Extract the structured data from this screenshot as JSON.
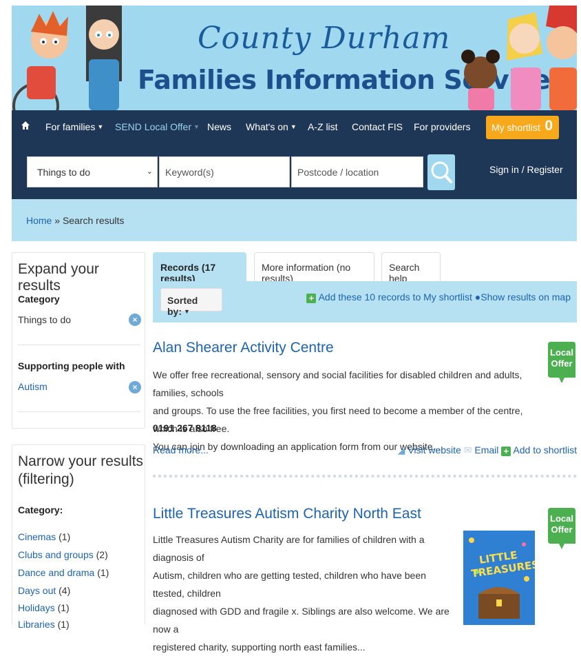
{
  "banner": {
    "title_line1": "County Durham",
    "title_line2": "Families Information Service"
  },
  "nav": {
    "items": [
      {
        "label": "For families",
        "dropdown": true
      },
      {
        "label": "SEND Local Offer",
        "dropdown": true
      },
      {
        "label": "News",
        "dropdown": false
      },
      {
        "label": "What's on",
        "dropdown": true
      },
      {
        "label": "A-Z list",
        "dropdown": false
      },
      {
        "label": "Contact FIS",
        "dropdown": false
      },
      {
        "label": "For providers",
        "dropdown": false
      }
    ],
    "shortlist_label": "My shortlist",
    "shortlist_count": "0",
    "home_icon": "home-icon"
  },
  "search": {
    "category_value": "Things to do",
    "keyword_placeholder": "Keyword(s)",
    "postcode_placeholder": "Postcode / location",
    "signin_label": "Sign in / Register"
  },
  "breadcrumb": {
    "home": "Home",
    "separator": " » ",
    "current": "Search results"
  },
  "sidebar": {
    "expand_heading": "Expand your results",
    "category_label": "Category",
    "category_value": "Things to do",
    "supporting_label": "Supporting people with",
    "supporting_value": "Autism",
    "narrow_heading_1": "Narrow your results",
    "narrow_heading_2": "(filtering)",
    "filter_category_label": "Category:",
    "filter_categories": [
      {
        "name": "Cinemas",
        "count": "(1)"
      },
      {
        "name": "Clubs and groups",
        "count": "(2)"
      },
      {
        "name": "Dance and drama",
        "count": "(1)"
      },
      {
        "name": "Days out",
        "count": "(4)"
      },
      {
        "name": "Holidays",
        "count": "(1)"
      },
      {
        "name": "Libraries",
        "count": "(1)"
      }
    ]
  },
  "tabs": [
    {
      "label": "Records (17 results)",
      "active": true
    },
    {
      "label": "More information (no results)",
      "active": false
    },
    {
      "label": "Search help",
      "active": false
    }
  ],
  "toolbar": {
    "sort_label": "Sorted by:",
    "add_all_label": "Add these 10 records to My shortlist",
    "map_label": "Show results on map"
  },
  "results": [
    {
      "title": "Alan Shearer Activity Centre",
      "desc_lines": [
        "We offer free recreational, sensory and social facilities for disabled children and adults, families, schools",
        "and groups. To use the free facilities, you first need to become a member of the centre, which is also free.",
        "You can join by downloading an application form from our website...."
      ],
      "phone": "0191 267 8118",
      "read_more": "Read more...",
      "visit_website": "Visit website",
      "email": "Email",
      "add_shortlist": "Add to shortlist",
      "badge_line1": "Local",
      "badge_line2": "Offer"
    },
    {
      "title": "Little Treasures Autism Charity North East",
      "desc_lines": [
        "Little Treasures Autism Charity are for families of children with a diagnosis of",
        "Autism, children who are getting tested, children who have been ttested, children",
        "diagnosed with GDD and fragile x. Siblings are also welcome. We are now a",
        "registered charity, supporting north east families..."
      ],
      "badge_line1": "Local",
      "badge_line2": "Offer",
      "thumb_text": "LITTLE TREASURES"
    }
  ],
  "colors": {
    "banner_bg": "#9fd8ef",
    "nav_bg": "#1e3756",
    "light_band": "#b5e1f3",
    "link": "#1d63b0",
    "shortlist_orange": "#f7a81b",
    "badge_green": "#4caf50"
  }
}
